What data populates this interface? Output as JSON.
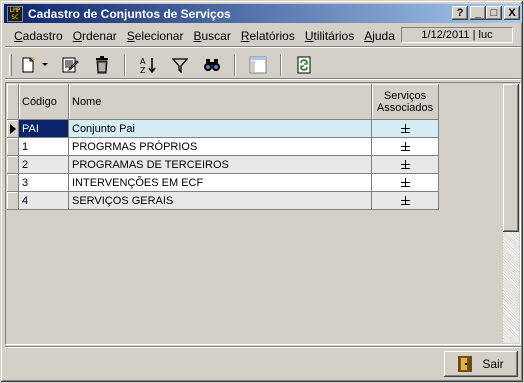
{
  "window": {
    "title": "Cadastro de Conjuntos de Serviços",
    "app_icon_text": "LMP SC",
    "buttons": {
      "help": "?",
      "minimize": "_",
      "maximize": "□",
      "close": "X"
    }
  },
  "menu": {
    "items": [
      {
        "first": "C",
        "rest": "adastro"
      },
      {
        "first": "O",
        "rest": "rdenar"
      },
      {
        "first": "S",
        "rest": "elecionar"
      },
      {
        "first": "B",
        "rest": "uscar"
      },
      {
        "first": "R",
        "rest": "elatórios"
      },
      {
        "first": "U",
        "rest": "tilitários"
      },
      {
        "first": "A",
        "rest": "juda"
      }
    ],
    "status": "1/12/2011 | luc"
  },
  "toolbar": {
    "icons": [
      "new-icon",
      "dropdown-arrow-icon",
      "edit-icon",
      "delete-icon",
      "sort-az-icon",
      "filter-icon",
      "find-icon",
      "window-icon",
      "refresh-icon"
    ]
  },
  "grid": {
    "columns": {
      "codigo": "Código",
      "nome": "Nome",
      "servicos_line1": "Serviços",
      "servicos_line2": "Associados"
    },
    "rows": [
      {
        "codigo": "PAI",
        "nome": "Conjunto Pai"
      },
      {
        "codigo": "1",
        "nome": "PROGRMAS PRÓPRIOS"
      },
      {
        "codigo": "2",
        "nome": "PROGRAMAS DE TERCEIROS"
      },
      {
        "codigo": "3",
        "nome": "INTERVENÇÕES EM ECF"
      },
      {
        "codigo": "4",
        "nome": "SERVIÇOS GERAIS"
      }
    ],
    "selected_row": 0
  },
  "footer": {
    "exit_label": "Sair"
  },
  "colors": {
    "titlebar_start": "#0a246a",
    "titlebar_end": "#a6caf0",
    "selected_row": "#d4ecf2"
  }
}
